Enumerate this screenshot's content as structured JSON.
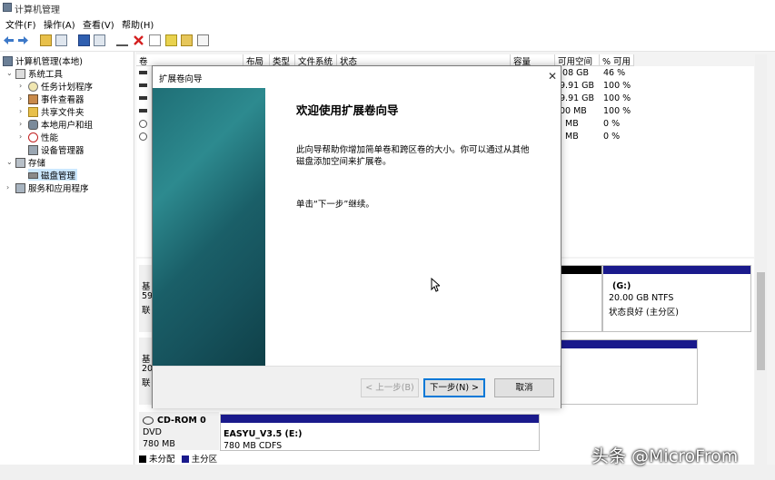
{
  "window": {
    "title": "计算机管理"
  },
  "menu": [
    "文件(F)",
    "操作(A)",
    "查看(V)",
    "帮助(H)"
  ],
  "tree": {
    "root": "计算机管理(本地)",
    "system_tools": "系统工具",
    "task_scheduler": "任务计划程序",
    "event_viewer": "事件查看器",
    "shared_folders": "共享文件夹",
    "local_users": "本地用户和组",
    "performance": "性能",
    "device_manager": "设备管理器",
    "storage": "存储",
    "disk_management": "磁盘管理",
    "services_apps": "服务和应用程序"
  },
  "columns": [
    "卷",
    "布局",
    "类型",
    "文件系统",
    "状态",
    "容量",
    "可用空间",
    "% 可用"
  ],
  "volumes": [
    {
      "free": ".08 GB",
      "pct": "46 %"
    },
    {
      "free": "9.91 GB",
      "pct": "100 %"
    },
    {
      "free": "9.91 GB",
      "pct": "100 %"
    },
    {
      "free": "00 MB",
      "pct": "100 %"
    },
    {
      "free": "MB",
      "pct": "0 %"
    },
    {
      "free": "MB",
      "pct": "0 %"
    }
  ],
  "disks": {
    "disk0_l1": "基",
    "disk0_l2": "59",
    "disk0_l3": "联",
    "disk1_l1": "基",
    "disk1_l2": "20",
    "disk1_l3": "联",
    "cdrom_name": "CD-ROM 0",
    "cdrom_type": "DVD",
    "cdrom_size": "780 MB",
    "cdrom_vol_name": "EASYU_V3.5  (E:)",
    "cdrom_vol_fs": "780 MB CDFS",
    "g_name": "(G:)",
    "g_fs": "20.00 GB NTFS",
    "g_status": "状态良好 (主分区)"
  },
  "legend": {
    "unallocated": "未分配",
    "primary": "主分区"
  },
  "dialog": {
    "title": "扩展卷向导",
    "heading": "欢迎使用扩展卷向导",
    "desc1": "此向导帮助你增加简单卷和跨区卷的大小。你可以通过从其他",
    "desc2": "磁盘添加空间来扩展卷。",
    "instruction": "单击“下一步”继续。",
    "back": "< 上一步(B)",
    "next": "下一步(N) >",
    "cancel": "取消"
  },
  "watermark": "头条 @MicroFrom",
  "colors": {
    "primary_partition": "#1a1a8c",
    "unallocated": "#000000",
    "selection": "#cce8ff"
  }
}
